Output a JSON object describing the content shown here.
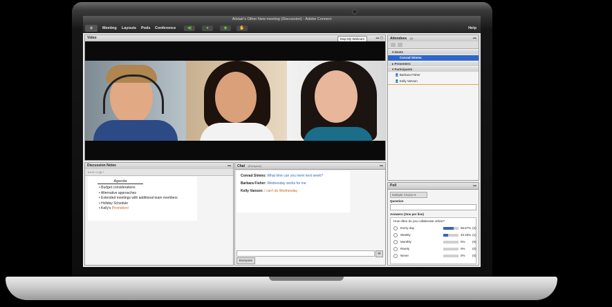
{
  "window": {
    "title": "Alistair's Other New meeting (Discussion) - Adobe Connect"
  },
  "menubar": {
    "items": [
      "Meeting",
      "Layouts",
      "Pods",
      "Conference"
    ],
    "help": "Help"
  },
  "video_pod": {
    "title": "Video",
    "stop_button": "Stop My Webcam"
  },
  "attendees": {
    "title": "Attendees",
    "count": "(3)",
    "sections": {
      "hosts": "Hosts",
      "presenters": "Presenters",
      "participants": "Participants"
    },
    "host": "Conrad Simms",
    "participants": [
      "Barbara Fisher",
      "Kelly Vanson"
    ]
  },
  "notes": {
    "title": "Discussion Notes",
    "heading": "Agenda",
    "items": [
      "Budget considerations",
      "Alternative approaches",
      "Extended meetings with additional team members",
      "Holiday Schedule"
    ],
    "last_prefix": "Kelly's",
    "last_link": "Promotion!"
  },
  "chat": {
    "title": "Chat",
    "scope": "(Everyone)",
    "messages": [
      {
        "sender": "Conrad Simms:",
        "text": "What time can you meet next week?"
      },
      {
        "sender": "Barbara Fisher:",
        "text": "Wednesday works for me"
      },
      {
        "sender": "Kelly Vanson:",
        "text": "I can't do Wednesday"
      }
    ],
    "tab": "Everyone"
  },
  "poll": {
    "title": "Poll",
    "type": "Multiple Choice",
    "question_label": "Question",
    "answers_label": "Answers (One per line)",
    "question": "How often do you collaborate online?",
    "options": [
      {
        "label": "Every day",
        "percent": 66.67,
        "pct_text": "66.67%",
        "count": "(2)"
      },
      {
        "label": "Weekly",
        "percent": 33.33,
        "pct_text": "33.33%",
        "count": "(1)"
      },
      {
        "label": "Monthly",
        "percent": 0,
        "pct_text": "0%",
        "count": "(0)"
      },
      {
        "label": "Rarely",
        "percent": 0,
        "pct_text": "0%",
        "count": "(0)"
      },
      {
        "label": "Never",
        "percent": 0,
        "pct_text": "0%",
        "count": "(0)"
      }
    ]
  },
  "colors": {
    "accent": "#3a63b3",
    "selected_row": "#2f66c9",
    "link_orange": "#c7621d"
  }
}
